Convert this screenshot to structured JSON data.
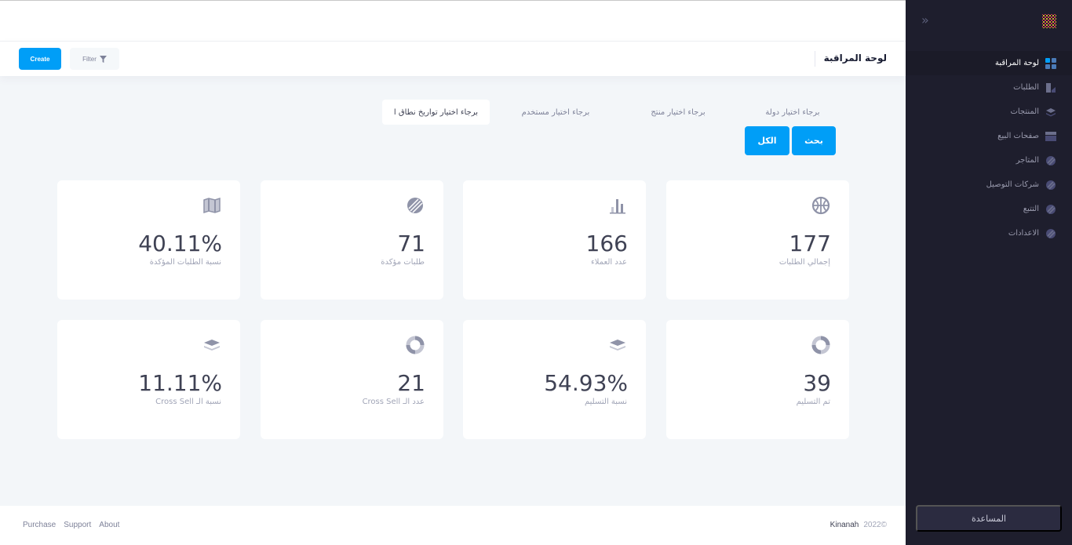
{
  "header": {
    "page_title": "لوحة المراقبة",
    "create_label": "Create",
    "filter_label": "Filter"
  },
  "filters": {
    "country": "برجاء اختيار دولة",
    "product": "برجاء اختيار منتج",
    "user": "برجاء اختيار مستخدم",
    "date_range": "برجاء اختيار تواريخ نطاق ا",
    "search_label": "بحث",
    "all_label": "الكل"
  },
  "cards": [
    {
      "value": "177",
      "label": "إجمالي الطلبات",
      "icon": "basketball-icon"
    },
    {
      "value": "166",
      "label": "عدد العملاء",
      "icon": "bar-chart-icon"
    },
    {
      "value": "71",
      "label": "طلبات مؤكدة",
      "icon": "globe-stripes-icon"
    },
    {
      "value": "40.11%",
      "label": "نسبة الطلبات المؤكدة",
      "icon": "map-icon"
    },
    {
      "value": "39",
      "label": "تم التسليم",
      "icon": "lifebuoy-icon"
    },
    {
      "value": "54.93%",
      "label": "نسبة التسليم",
      "icon": "layers-icon"
    },
    {
      "value": "21",
      "label": "عدد الـ Cross Sell",
      "icon": "lifebuoy-icon"
    },
    {
      "value": "11.11%",
      "label": "نسبة الـ Cross Sell",
      "icon": "layers-icon"
    }
  ],
  "sidebar": {
    "items": [
      {
        "label": "لوحة المراقبة",
        "icon": "dashboard-icon",
        "active": true
      },
      {
        "label": "الطلبات",
        "icon": "orders-icon"
      },
      {
        "label": "المنتجات",
        "icon": "layers-icon"
      },
      {
        "label": "صفحات البيع",
        "icon": "layout-icon"
      },
      {
        "label": "المتاجر",
        "icon": "stores-icon"
      },
      {
        "label": "شركات التوصيل",
        "icon": "shipping-icon"
      },
      {
        "label": "التتبع",
        "icon": "tracking-icon"
      },
      {
        "label": "الاعدادات",
        "icon": "settings-icon"
      }
    ],
    "help_label": "المساعدة"
  },
  "footer": {
    "links": [
      "Purchase",
      "Support",
      "About"
    ],
    "year": "2022©",
    "brand": "Kinanah"
  },
  "colors": {
    "primary": "#009ef7",
    "sidebar_bg": "#1e1e2d",
    "page_bg": "#f3f6f9"
  }
}
